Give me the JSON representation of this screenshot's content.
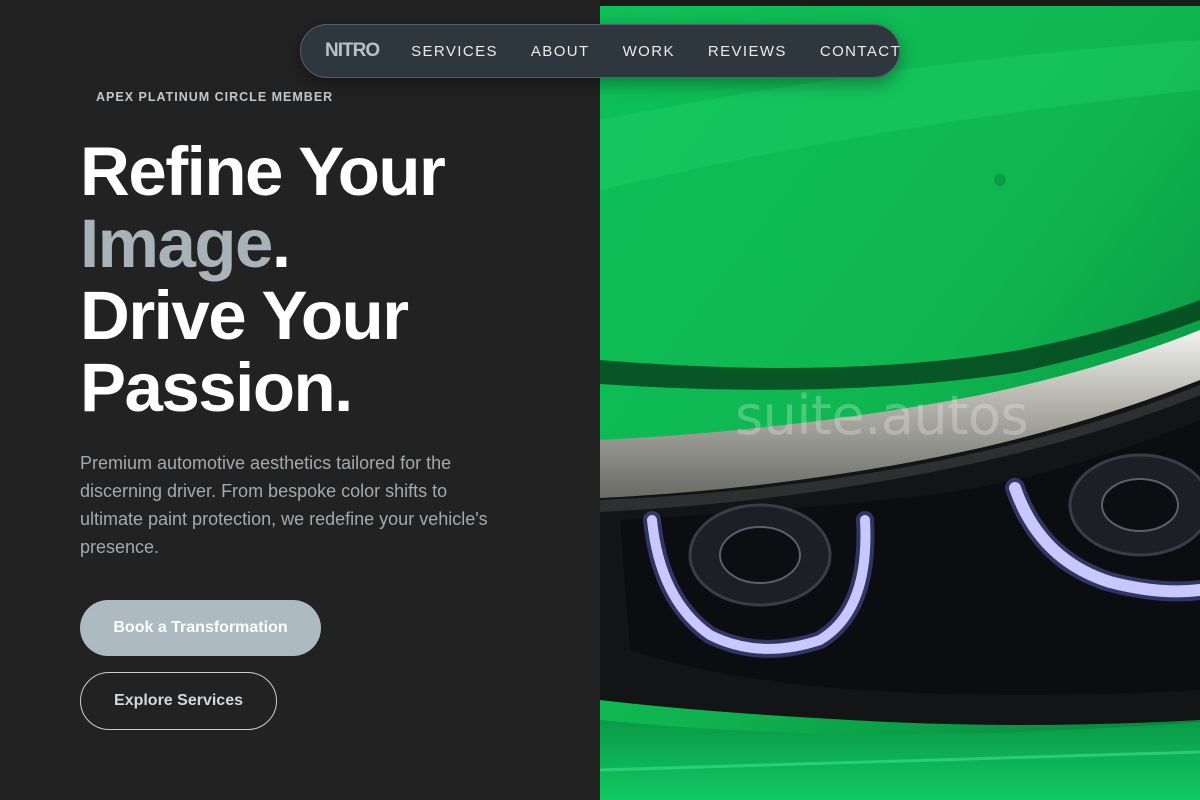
{
  "nav": {
    "logo": "NITRO",
    "links": [
      "SERVICES",
      "ABOUT",
      "WORK",
      "REVIEWS",
      "CONTACT"
    ]
  },
  "hero": {
    "badge": "APEX PLATINUM CIRCLE MEMBER",
    "headline_line1": "Refine Your",
    "headline_line2_word": "Image",
    "headline_line2_dot": ".",
    "headline_line3": "Drive Your",
    "headline_line4": "Passion.",
    "description": "Premium automotive aesthetics tailored for the discerning driver. From bespoke color shifts to ultimate paint protection, we redefine your vehicle's presence.",
    "primary_cta": "Book a Transformation",
    "secondary_cta": "Explore Services"
  },
  "image": {
    "subject": "green-car-headlight",
    "watermark": "suite.autos"
  },
  "colors": {
    "background": "#222222",
    "accent": "#adbac1",
    "car_green": "#0fc45a"
  }
}
